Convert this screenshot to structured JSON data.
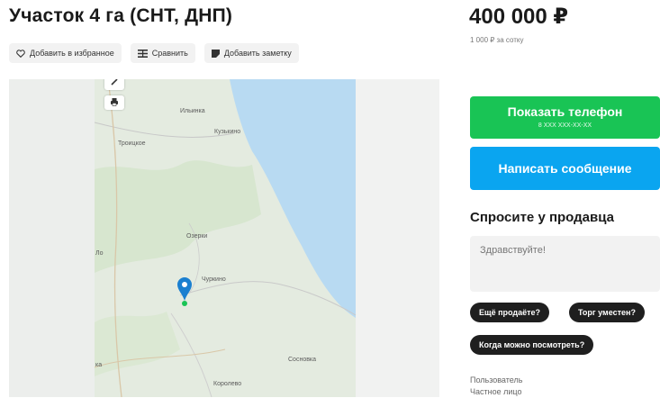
{
  "listing": {
    "title": "Участок 4 га (СНТ, ДНП)",
    "price": "400 000 ₽",
    "price_per_unit": "1 000 ₽ за сотку"
  },
  "actions": {
    "favorite_label": "Добавить в избранное",
    "compare_label": "Сравнить",
    "note_label": "Добавить заметку"
  },
  "map": {
    "labels": {
      "village_top": "Ильинка",
      "village_nw": "Троицкое",
      "village_ne": "Кузькино",
      "village_mid": "Озерки",
      "village_pin": "Чуркино",
      "village_w": "Ло",
      "village_se": "Сосновка",
      "village_sw": "ка",
      "village_bottom": "Королево"
    }
  },
  "contact": {
    "phone_button_label": "Показать телефон",
    "phone_masked": "8 XXX XXX-XX-XX",
    "message_button_label": "Написать сообщение"
  },
  "ask_seller": {
    "title": "Спросите у продавца",
    "message_value": "Здравствуйте!",
    "chips": [
      "Ещё продаёте?",
      "Торг уместен?",
      "Когда можно посмотреть?"
    ]
  },
  "seller": {
    "line1": "Пользователь",
    "line2": "Частное лицо"
  },
  "colors": {
    "phone_button": "#19c455",
    "message_button": "#0aa5f0",
    "map_pin": "#1a7fd0",
    "water": "#b8daf2"
  }
}
